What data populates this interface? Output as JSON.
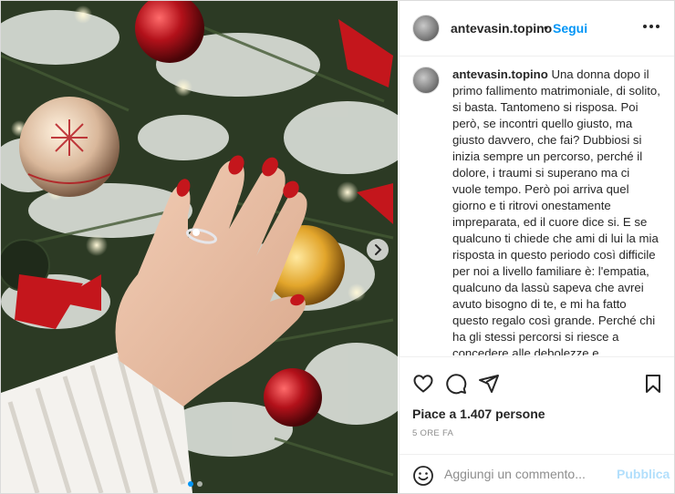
{
  "post": {
    "username": "antevasin.topino",
    "follow_label": "Segui",
    "caption": "Una donna dopo il primo fallimento matrimoniale, di solito, si basta. Tantomeno si risposa. Poi però, se incontri quello giusto, ma giusto davvero, che fai? Dubbiosi si inizia sempre un percorso, perché il dolore, i traumi si superano ma ci vuole tempo. Però poi arriva quel giorno e ti ritrovi onestamente impreparata, ed il cuore dice si. E se qualcuno ti chiede che ami di lui la mia risposta in questo periodo così difficile per noi a livello familiare è: l'empatia, qualcuno da lassù sapeva che avrei avuto bisogno di te, e mi ha fatto questo regalo così grande. Perché chi ha gli stessi percorsi si riesce a concedere alle debolezze e all'umanitá. Perché se posso permettermi amore mio, io amo me",
    "likes_text": "Piace a 1.407 persone",
    "time_text": "5 ORE FA",
    "carousel": {
      "total": 2,
      "current": 1
    }
  },
  "comment": {
    "placeholder": "Aggiungi un commento...",
    "publish_label": "Pubblica"
  },
  "icons": {
    "more": "more-options-icon",
    "like": "heart-icon",
    "comment": "comment-icon",
    "share": "paper-plane-icon",
    "save": "bookmark-icon",
    "emoji": "emoji-icon",
    "next": "chevron-right-icon"
  },
  "colors": {
    "accent": "#0095f6",
    "publish_disabled": "#b2dffc",
    "nail_polish": "#c4161c"
  }
}
